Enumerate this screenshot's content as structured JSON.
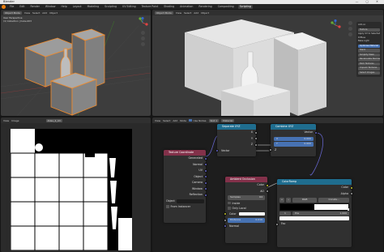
{
  "window": {
    "title": "Blender"
  },
  "menubar": {
    "menus": [
      "File",
      "Edit",
      "Render",
      "Window",
      "Help"
    ],
    "workspaces": [
      "Layout",
      "Modeling",
      "Sculpting",
      "UV Editing",
      "Texture Paint",
      "Shading",
      "Animation",
      "Rendering",
      "Compositing",
      "Scripting"
    ],
    "active_workspace": "Scripting"
  },
  "viewport_left": {
    "mode": "Object Mode",
    "menus": [
      "View",
      "Select",
      "Add",
      "Object"
    ],
    "view_label": "User Perspective",
    "collection_label": "(1) Collection | Cube.003"
  },
  "viewport_right": {
    "mode": "Object Mode",
    "menus": [
      "View",
      "Select",
      "Add",
      "Object"
    ],
    "panel": {
      "header": "Add-on",
      "items": [
        "Texture",
        "Apply UV to Selected",
        "Diffuse",
        "Bake Light",
        "Optimise Material",
        "Stack",
        "Simplify Mask",
        "Recalculate Normals",
        "Pack Textures",
        "Unpack Textures",
        "Select Images"
      ]
    }
  },
  "image_editor": {
    "image_name": "Atlas_4_UV",
    "menus": [
      "View",
      "Image"
    ]
  },
  "node_editor": {
    "menus": [
      "View",
      "Select",
      "Add",
      "Node"
    ],
    "use_nodes_label": "Use Nodes",
    "slot_label": "Slot 1",
    "material_label": "Material",
    "nodes": {
      "separate_xyz": {
        "title": "Separate XYZ",
        "outputs": [
          "X",
          "Y",
          "Z"
        ],
        "inputs": [
          "Vector"
        ]
      },
      "combine_xyz": {
        "title": "Combine XYZ",
        "outputs": [
          "Vector"
        ],
        "inputs": [
          {
            "label": "X",
            "value": "0.000"
          },
          {
            "label": "Y",
            "value": "0.000"
          }
        ],
        "z_label": "Z"
      },
      "texture_coordinate": {
        "title": "Texture Coordinate",
        "outputs": [
          "Generated",
          "Normal",
          "UV",
          "Object",
          "Camera",
          "Window",
          "Reflection"
        ],
        "object_label": "Object",
        "from_instancer": "From Instancer"
      },
      "ambient_occlusion": {
        "title": "Ambient Occlusion",
        "outputs": [
          "Color",
          "AO"
        ],
        "samples_label": "Samples",
        "samples_value": "64",
        "inside_label": "Inside",
        "only_local_label": "Only Local",
        "inputs": [
          "Color"
        ],
        "distance_label": "Distance",
        "distance_value": "0.010",
        "normal_label": "Normal"
      },
      "color_ramp": {
        "title": "ColorRamp",
        "outputs": [
          "Color",
          "Alpha"
        ],
        "mode": "RGB",
        "interpolation": "Consta...",
        "stop_index": "1",
        "pos_label": "Pos",
        "pos_value": "1.000",
        "input": "Fac"
      }
    }
  },
  "colors": {
    "header_output_node": "#83314a",
    "header_converter": "#1f6d8f",
    "header_input": "#83314a",
    "header_shader": "#8a3b2f",
    "accent_blue": "#4772b3",
    "socket_yellow": "#c7c729",
    "socket_purple": "#6363c7",
    "socket_grey": "#a1a1a1",
    "selection_orange": "#f08a2a"
  }
}
